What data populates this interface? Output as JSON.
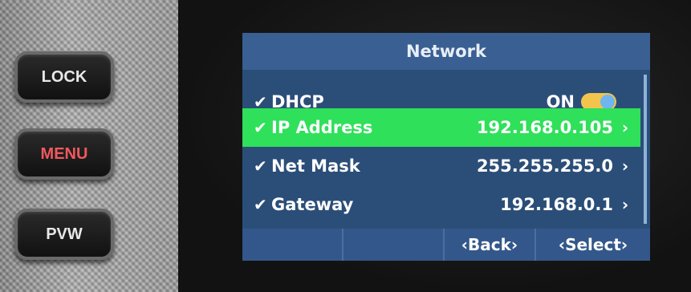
{
  "hardware": {
    "lock_label": "LOCK",
    "menu_label": "MENU",
    "pvw_label": "PVW"
  },
  "screen": {
    "title": "Network",
    "rows": [
      {
        "check": "✔",
        "label": "DHCP",
        "value": "ON",
        "control": "toggle-on"
      },
      {
        "check": "✔",
        "label": "IP Address",
        "value": "192.168.0.105",
        "chevron": "›",
        "selected": true
      },
      {
        "check": "✔",
        "label": "Net Mask",
        "value": "255.255.255.0",
        "chevron": "›"
      },
      {
        "check": "✔",
        "label": "Gateway",
        "value": "192.168.0.1",
        "chevron": "›"
      }
    ],
    "footer": {
      "back_label": "‹Back›",
      "select_label": "‹Select›"
    },
    "colors": {
      "title_bg": "#3a5f92",
      "screen_bg": "#2b4e78",
      "selected_row": "#2fe05a",
      "toggle_on": "#f3c44d"
    }
  }
}
